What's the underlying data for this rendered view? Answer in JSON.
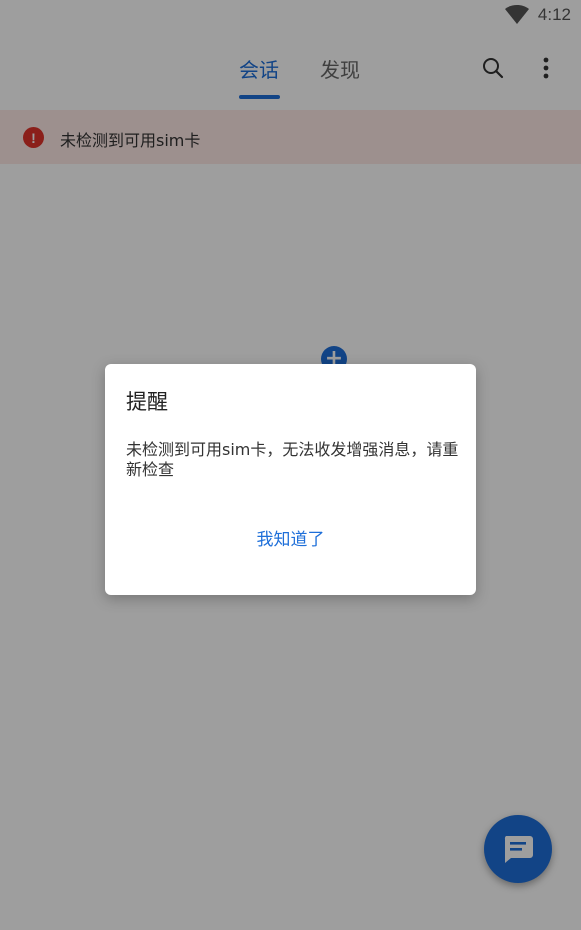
{
  "status_bar": {
    "time": "4:12",
    "wifi_icon": "wifi-icon"
  },
  "app_bar": {
    "tabs": [
      {
        "label": "会话",
        "active": true
      },
      {
        "label": "发现",
        "active": false
      }
    ],
    "search_icon": "search-icon",
    "more_icon": "more-vert-icon"
  },
  "banner": {
    "icon": "error-icon",
    "icon_glyph": "!",
    "text": "未检测到可用sim卡"
  },
  "dialog": {
    "title": "提醒",
    "message": "未检测到可用sim卡，无法收发增强消息，请重新检查",
    "button_label": "我知道了"
  },
  "colors": {
    "accent": "#1e6fd9",
    "error": "#e0322b",
    "banner_bg": "#fde8e6"
  }
}
